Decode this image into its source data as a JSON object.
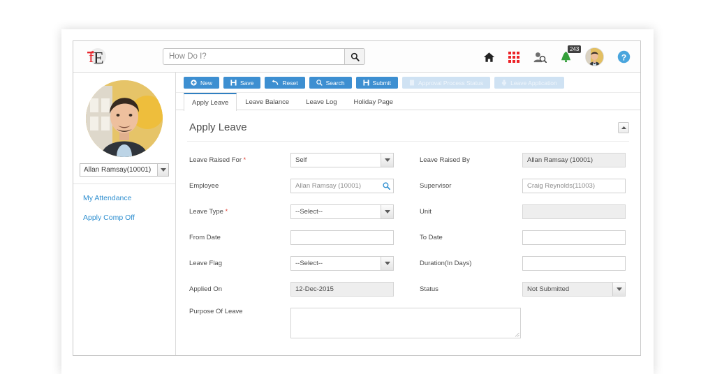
{
  "header": {
    "logo_name": "fe-logo",
    "search": {
      "placeholder": "How Do I?",
      "value": "",
      "button_icon": "search-icon"
    },
    "icons": [
      {
        "name": "home-icon",
        "label": "Home"
      },
      {
        "name": "app-grid-icon",
        "label": "Apps"
      },
      {
        "name": "people-search-icon",
        "label": "Find People"
      },
      {
        "name": "notification-bell-icon",
        "label": "Notifications",
        "badge": "243"
      },
      {
        "name": "user-avatar",
        "label": "Profile"
      },
      {
        "name": "help-icon",
        "label": "Help"
      }
    ]
  },
  "sidebar": {
    "profile_photo_name": "profile-photo",
    "employee_select": {
      "value": "Allan Ramsay(10001)",
      "options": [
        "Allan Ramsay(10001)"
      ]
    },
    "links": [
      {
        "label": "My Attendance",
        "name": "sidebar-link-my-attendance"
      },
      {
        "label": "Apply Comp Off",
        "name": "sidebar-link-apply-comp-off"
      }
    ]
  },
  "toolbar": {
    "buttons": [
      {
        "label": "New",
        "icon": "plus-circle-icon",
        "name": "new-button",
        "disabled": false
      },
      {
        "label": "Save",
        "icon": "save-disk-icon",
        "name": "save-button",
        "disabled": false
      },
      {
        "label": "Reset",
        "icon": "undo-arrow-icon",
        "name": "reset-button",
        "disabled": false
      },
      {
        "label": "Search",
        "icon": "search-icon",
        "name": "search-button",
        "disabled": false
      },
      {
        "label": "Submit",
        "icon": "submit-disk-icon",
        "name": "submit-button",
        "disabled": false
      },
      {
        "label": "Approval Process Status",
        "icon": "document-icon",
        "name": "approval-process-status-button",
        "disabled": true
      },
      {
        "label": "Leave Application",
        "icon": "print-icon",
        "name": "leave-application-button",
        "disabled": true
      }
    ]
  },
  "tabs": [
    {
      "label": "Apply Leave",
      "name": "tab-apply-leave",
      "active": true
    },
    {
      "label": "Leave Balance",
      "name": "tab-leave-balance",
      "active": false
    },
    {
      "label": "Leave Log",
      "name": "tab-leave-log",
      "active": false
    },
    {
      "label": "Holiday Page",
      "name": "tab-holiday-page",
      "active": false
    }
  ],
  "panel": {
    "title": "Apply Leave",
    "collapse_icon": "chevron-up-icon"
  },
  "form": {
    "rows": [
      {
        "left": {
          "label": "Leave Raised For",
          "required": true,
          "value": "Self",
          "type": "select",
          "readonly": false
        },
        "right": {
          "label": "Leave Raised By",
          "required": false,
          "value": "Allan Ramsay (10001)",
          "type": "text",
          "readonly": true
        }
      },
      {
        "left": {
          "label": "Employee",
          "required": false,
          "value": "Allan Ramsay (10001)",
          "type": "lookup",
          "readonly": false
        },
        "right": {
          "label": "Supervisor",
          "required": false,
          "value": "Craig Reynolds(11003)",
          "type": "text",
          "readonly": false
        }
      },
      {
        "left": {
          "label": "Leave Type",
          "required": true,
          "value": "--Select--",
          "type": "select",
          "readonly": false
        },
        "right": {
          "label": "Unit",
          "required": false,
          "value": "",
          "type": "text",
          "readonly": true
        }
      },
      {
        "left": {
          "label": "From Date",
          "required": false,
          "value": "",
          "type": "text",
          "readonly": false
        },
        "right": {
          "label": "To Date",
          "required": false,
          "value": "",
          "type": "text",
          "readonly": false
        }
      },
      {
        "left": {
          "label": "Leave Flag",
          "required": false,
          "value": "--Select--",
          "type": "select",
          "readonly": false
        },
        "right": {
          "label": "Duration(In Days)",
          "required": false,
          "value": "",
          "type": "text",
          "readonly": false
        }
      },
      {
        "left": {
          "label": "Applied On",
          "required": false,
          "value": "12-Dec-2015",
          "type": "text",
          "readonly": true
        },
        "right": {
          "label": "Status",
          "required": false,
          "value": "Not Submitted",
          "type": "select",
          "readonly": false
        }
      }
    ],
    "purpose": {
      "label": "Purpose Of Leave",
      "value": ""
    }
  },
  "colors": {
    "primary_blue": "#3d8fd1",
    "disabled_blue": "#cfe2f3",
    "link_blue": "#2f8fd0",
    "accent_red": "#ec2227",
    "bell_green": "#34a03a",
    "badge_gray": "#3f3f3f",
    "required_red": "#e03b2f"
  }
}
